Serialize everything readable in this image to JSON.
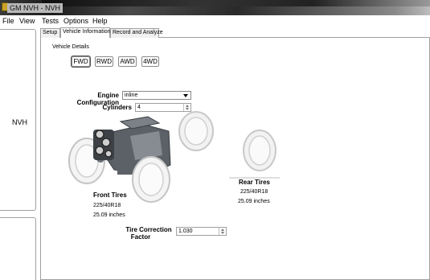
{
  "window": {
    "title": "GM NVH - NVH"
  },
  "menu": {
    "items": [
      "File",
      "View",
      "Tests",
      "Options",
      "Help"
    ]
  },
  "left_panel": {
    "label": "NVH"
  },
  "tabs": [
    {
      "label": "Setup",
      "active": false
    },
    {
      "label": "Vehicle Information",
      "active": true
    },
    {
      "label": "Record and Analyze",
      "active": false
    }
  ],
  "vehicle_details": {
    "group_label": "Vehicle Details",
    "drive_types": [
      "FWD",
      "RWD",
      "AWD",
      "4WD"
    ],
    "selected_drive": "FWD"
  },
  "engine": {
    "configuration_label": "Engine Configuration",
    "configuration_value": "inline",
    "cylinders_label": "Cylinders",
    "cylinders_value": "4"
  },
  "front_tires": {
    "label": "Front Tires",
    "size": "225/40R18",
    "diameter": "25.09 inches"
  },
  "rear_tires": {
    "label": "Rear Tires",
    "size": "225/40R18",
    "diameter": "25.09 inches"
  },
  "tire_correction": {
    "label_line1": "Tire Correction",
    "label_line2": "Factor",
    "value": "1.030"
  },
  "colors": {
    "engine": "#5a6066",
    "tire": "#d8d8d8",
    "window_border": "#a0a0a0"
  }
}
